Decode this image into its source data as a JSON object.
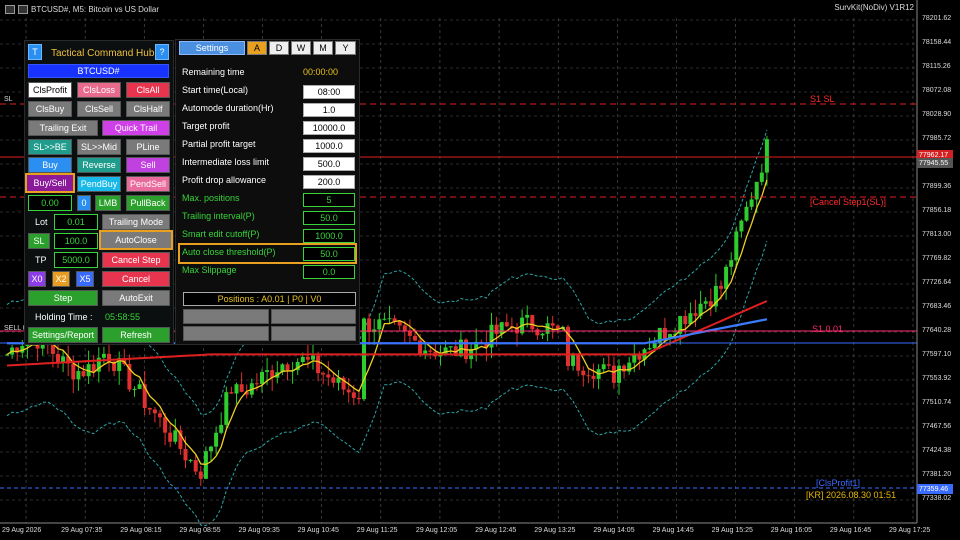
{
  "window": {
    "title": "BTCUSD#, M5:  Bitcoin vs US Dollar",
    "right_title": "SurvKit(NoDiv) V1R12"
  },
  "hub": {
    "t_label": "T",
    "title": "Tactical Command Hub",
    "help_label": "?",
    "symbol": "BTCUSD#",
    "buttons": {
      "clsprofit": "ClsProfit",
      "clsloss": "ClsLoss",
      "clsall": "ClsAll",
      "clsbuy": "ClsBuy",
      "clssell": "ClsSell",
      "clshalf": "ClsHalf",
      "trailing_exit": "Trailing Exit",
      "quick_trail": "Quick Trail",
      "sl_be": "SL>>BE",
      "sl_mid": "SL>>Mid",
      "pline": "PLine",
      "buy": "Buy",
      "reverse": "Reverse",
      "sell": "Sell",
      "buysell": "Buy/Sell",
      "pendbuy": "PendBuy",
      "pendsell": "PendSell",
      "lmb": "LMB",
      "pullback": "PullBack",
      "trailing_mode": "Trailing Mode",
      "sl": "SL",
      "autoclose": "AutoClose",
      "cancel_step": "Cancel Step",
      "x0": "X0",
      "x2": "X2",
      "x5": "X5",
      "cancel": "Cancel",
      "step": "Step",
      "autoexit": "AutoExit",
      "settings_report": "Settings/Report",
      "refresh": "Refresh"
    },
    "fields": {
      "price_value": "0.00",
      "count_value": "0",
      "lot_label": "Lot",
      "lot_value": "0.01",
      "sl_value": "100.0",
      "tp_label": "TP",
      "tp_value": "5000.0"
    },
    "holding_label": "Holding Time :",
    "holding_value": "05:58:55"
  },
  "settings": {
    "tabs": [
      "Settings",
      "A",
      "D",
      "W",
      "M",
      "Y"
    ],
    "remaining_label": "Remaining time",
    "remaining_value": "00:00:00",
    "rows": [
      {
        "label": "Start time(Local)",
        "value": "08:00"
      },
      {
        "label": "Automode duration(Hr)",
        "value": "1.0"
      },
      {
        "label": "Target profit",
        "value": "10000.0"
      },
      {
        "label": "Partial profit target",
        "value": "1000.0"
      },
      {
        "label": "Intermediate loss limit",
        "value": "500.0"
      },
      {
        "label": "Profit drop allowance",
        "value": "200.0"
      },
      {
        "label": "Max. positions",
        "value": "5"
      },
      {
        "label": "Trailing interval(P)",
        "value": "50.0"
      },
      {
        "label": "Smart edit cutoff(P)",
        "value": "1000.0"
      },
      {
        "label": "Auto close threshold(P)",
        "value": "50.0"
      },
      {
        "label": "Max Slippage",
        "value": "0.0"
      }
    ],
    "positions": "Positions : A0.01 | P0 | V0"
  },
  "chart_data": {
    "type": "candlestick",
    "symbol": "BTCUSD#",
    "timeframe": "M5",
    "ylim": [
      77295.0,
      78223.0
    ],
    "y_ticks": [
      "78201.62",
      "78158.44",
      "78115.26",
      "78072.08",
      "78028.90",
      "77985.72",
      "77942.54",
      "77899.36",
      "77856.18",
      "77813.00",
      "77769.82",
      "77726.64",
      "77683.46",
      "77640.28",
      "77597.10",
      "77553.92",
      "77510.74",
      "77467.56",
      "77424.38",
      "77381.20",
      "77338.02"
    ],
    "x_ticks": [
      "29 Aug 2026",
      "29 Aug 07:35",
      "29 Aug 08:15",
      "29 Aug 08:55",
      "29 Aug 09:35",
      "29 Aug 10:45",
      "29 Aug 11:25",
      "29 Aug 12:05",
      "29 Aug 12:45",
      "29 Aug 13:25",
      "29 Aug 14:05",
      "29 Aug 14:45",
      "29 Aug 15:25",
      "29 Aug 16:05",
      "29 Aug 16:45",
      "29 Aug 17:25"
    ],
    "levels": [
      {
        "label": "S1 SL",
        "color": "#ff2b2b"
      },
      {
        "label": "[Cancel Step1(SL)]",
        "color": "#ff2b2b"
      },
      {
        "label": "S1 0.01",
        "color": "#ff2b6e"
      },
      {
        "label": "[ClsProfit1]",
        "color": "#3a6bff"
      },
      {
        "label": "[KR] 2026.08.30 01:51",
        "color": "#e6b800"
      }
    ],
    "left_labels": [
      "SL",
      "SELL 0"
    ],
    "price_tags": [
      {
        "value": "77962.17",
        "color": "#d42020"
      },
      {
        "value": "77945.55",
        "color": "#555555"
      },
      {
        "value": "77359.46",
        "color": "#3a6bff"
      }
    ]
  }
}
